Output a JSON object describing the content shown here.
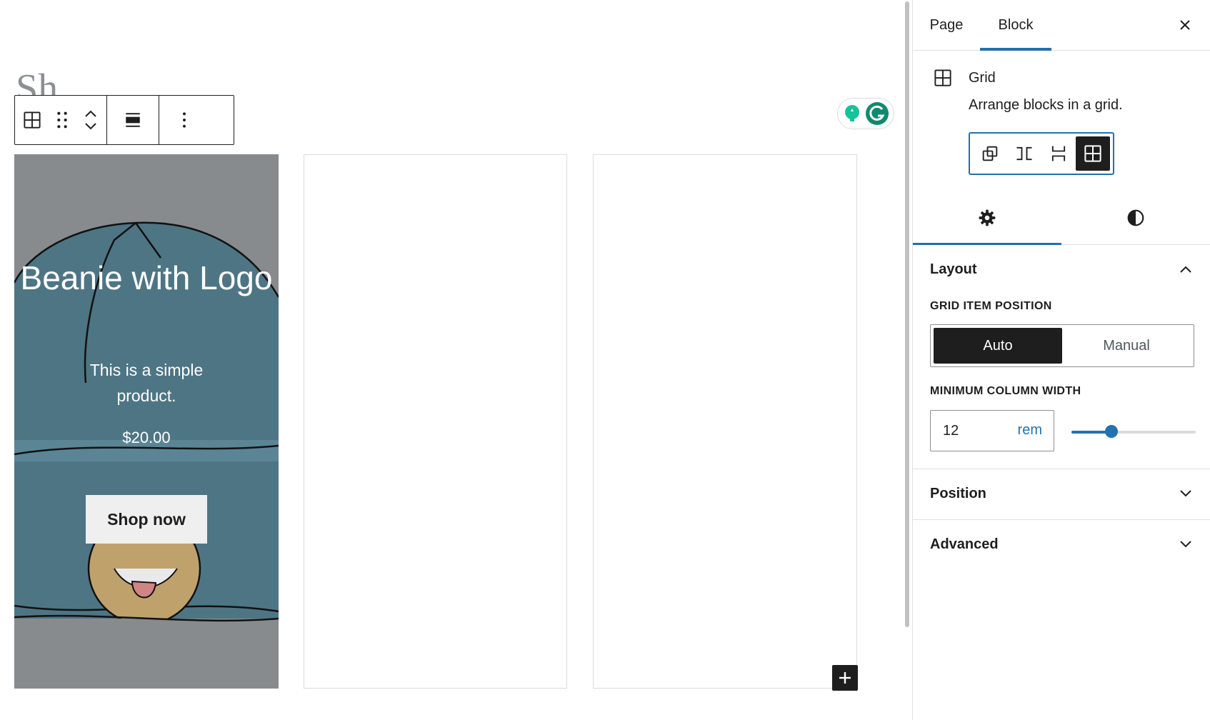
{
  "editor": {
    "title_fragment": "Sh",
    "toolbar": {
      "block_type_icon": "grid-icon",
      "drag_icon": "drag-handle-icon",
      "move_up_icon": "chevron-up-icon",
      "move_down_icon": "chevron-down-icon",
      "align_icon": "align-wide-icon",
      "options_icon": "more-vertical-icon"
    },
    "product_card": {
      "title": "Beanie with Logo",
      "description": "This is a simple product.",
      "price": "$20.00",
      "button_label": "Shop now",
      "overlay_color": "#878b8e"
    },
    "add_block_icon": "plus-icon",
    "grammarly": {
      "icons": [
        "lightbulb-icon",
        "grammarly-icon"
      ],
      "colors": [
        "#15c39a",
        "#0f8a6e"
      ]
    }
  },
  "sidebar": {
    "tabs": [
      {
        "label": "Page",
        "active": false
      },
      {
        "label": "Block",
        "active": true
      }
    ],
    "close_icon": "close-icon",
    "block_card": {
      "icon": "grid-icon",
      "name": "Grid",
      "description": "Arrange blocks in a grid."
    },
    "variations": [
      {
        "icon": "group-icon",
        "active": false
      },
      {
        "icon": "row-icon",
        "active": false
      },
      {
        "icon": "stack-icon",
        "active": false
      },
      {
        "icon": "grid-icon",
        "active": true
      }
    ],
    "subtabs": [
      {
        "icon": "gear-icon",
        "active": true
      },
      {
        "icon": "contrast-icon",
        "active": false
      }
    ],
    "layout_panel": {
      "title": "Layout",
      "expanded": true,
      "grid_item_position_label": "GRID ITEM POSITION",
      "position_options": [
        "Auto",
        "Manual"
      ],
      "position_selected": "Auto",
      "min_col_width_label": "MINIMUM COLUMN WIDTH",
      "min_col_width_value": "12",
      "min_col_width_unit": "rem",
      "slider_fraction": 0.32
    },
    "position_panel": {
      "title": "Position",
      "expanded": false
    },
    "advanced_panel": {
      "title": "Advanced",
      "expanded": false
    },
    "accent_color": "#2271b1"
  }
}
